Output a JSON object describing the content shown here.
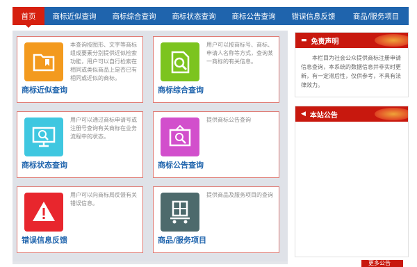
{
  "nav": {
    "items": [
      {
        "label": "首页"
      },
      {
        "label": "商标近似查询"
      },
      {
        "label": "商标综合查询"
      },
      {
        "label": "商标状态查询"
      },
      {
        "label": "商标公告查询"
      },
      {
        "label": "错误信息反馈"
      },
      {
        "label": "商品/服务项目"
      }
    ]
  },
  "cards": [
    {
      "title": "商标近似查询",
      "desc": "本查询按图形、文字等商标组成要素分别提供近似检索功能，用户可以自行检索在相同或类似商品上是否已有相同或近似的商标。",
      "icon": "folder-bookmark-icon",
      "color": "#f39a1e"
    },
    {
      "title": "商标综合查询",
      "desc": "用户可以按商标号、商标、申请人名称等方式，查询某一商标的有关信息。",
      "icon": "document-search-icon",
      "color": "#7cc41f"
    },
    {
      "title": "商标状态查询",
      "desc": "用户可以通过商标申请号或注册号查询有关商标在业务流程中的状态。",
      "icon": "monitor-search-icon",
      "color": "#3fc7e0"
    },
    {
      "title": "商标公告查询",
      "desc": "提供商标公告查询",
      "icon": "board-search-icon",
      "color": "#d24fcc"
    },
    {
      "title": "错误信息反馈",
      "desc": "用户可以向商标局反馈有关错误信息。",
      "icon": "warning-icon",
      "color": "#e8262d"
    },
    {
      "title": "商品/服务项目",
      "desc": "提供商品及服务项目的查询",
      "icon": "cart-icon",
      "color": "#4d6a6c"
    }
  ],
  "side": {
    "disclaimer_title": "免责声明",
    "disclaimer_text": "本栏目为社会公众提供商标注册申请信息查询，本系统的数据信息并非实时更新，有一定滞后性，仅供参考，不具有法律效力。",
    "notice_title": "本站公告"
  },
  "more_label": "更多公告"
}
